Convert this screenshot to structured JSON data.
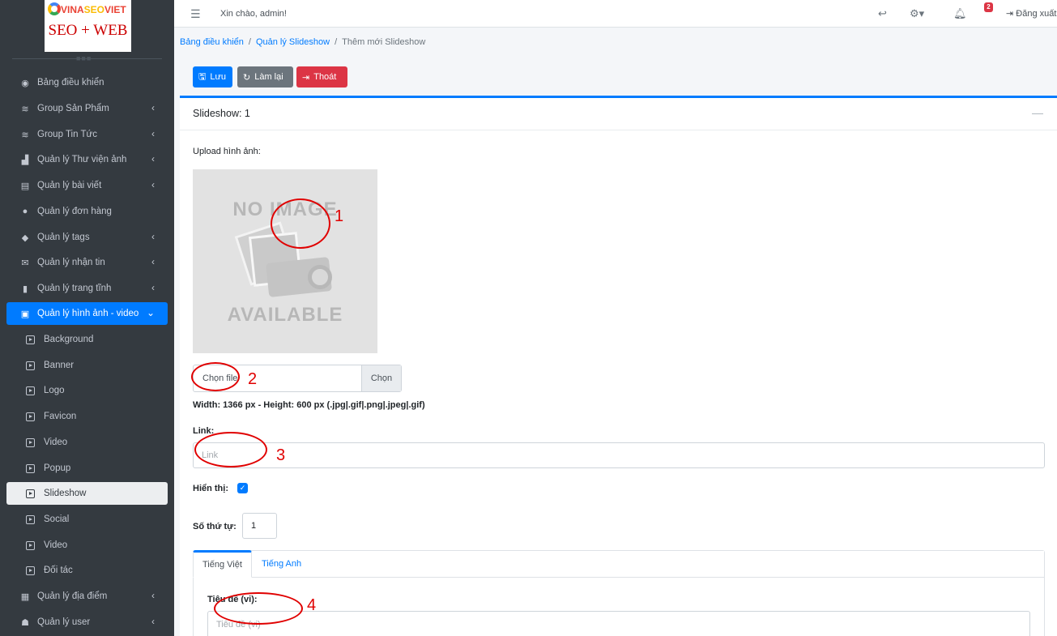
{
  "brand": {
    "top_vina": "VINA",
    "top_seo": "SEO",
    "top_viet": "VIET",
    "bottom": "SEO + WEB"
  },
  "sidebar": {
    "items": [
      {
        "label": "Bảng điều khiển",
        "icon": "dashboard-icon"
      },
      {
        "label": "Group Sản Phẩm",
        "icon": "layers-icon"
      },
      {
        "label": "Group Tin Tức",
        "icon": "layers-icon"
      },
      {
        "label": "Quản lý Thư viện ảnh",
        "icon": "gallery-icon"
      },
      {
        "label": "Quản lý bài viết",
        "icon": "article-icon"
      },
      {
        "label": "Quản lý đơn hàng",
        "icon": "shopping-bag-icon"
      },
      {
        "label": "Quản lý tags",
        "icon": "tags-icon"
      },
      {
        "label": "Quản lý nhận tin",
        "icon": "envelope-icon"
      },
      {
        "label": "Quản lý trang tĩnh",
        "icon": "bookmark-icon"
      },
      {
        "label": "Quản lý hình ảnh - video",
        "icon": "photo-video-icon"
      }
    ],
    "subitems": [
      "Background",
      "Banner",
      "Logo",
      "Favicon",
      "Video",
      "Popup",
      "Slideshow",
      "Social",
      "Video",
      "Đối tác"
    ],
    "bottom_items": [
      {
        "label": "Quản lý địa điểm",
        "icon": "building-icon"
      },
      {
        "label": "Quản lý user",
        "icon": "users-icon"
      }
    ]
  },
  "topbar": {
    "greeting": "Xin chào, admin!",
    "notifications": "2",
    "logout": "Đăng xuất"
  },
  "breadcrumb": {
    "home": "Bảng điều khiển",
    "section": "Quản lý Slideshow",
    "current": "Thêm mới Slideshow"
  },
  "actions": {
    "save": "Lưu",
    "reset": "Làm lại",
    "exit": "Thoát"
  },
  "card": {
    "title": "Slideshow: 1",
    "upload_label": "Upload hình ảnh:",
    "noimage_top": "NO IMAGE",
    "noimage_bottom": "AVAILABLE",
    "file_placeholder": "Chọn file",
    "file_button": "Chọn",
    "size_hint": "Width: 1366 px - Height: 600 px (.jpg|.gif|.png|.jpeg|.gif)",
    "link_label": "Link:",
    "link_placeholder": "Link",
    "visible_label": "Hiển thị:",
    "visible_checked": true,
    "order_label": "Số thứ tự:",
    "order_value": "1",
    "tabs": [
      "Tiếng Việt",
      "Tiếng Anh"
    ],
    "title_vi_label": "Tiêu đề (vi):",
    "title_vi_placeholder": "Tiêu đề (vi)"
  },
  "annotations": [
    "1",
    "2",
    "3",
    "4"
  ]
}
